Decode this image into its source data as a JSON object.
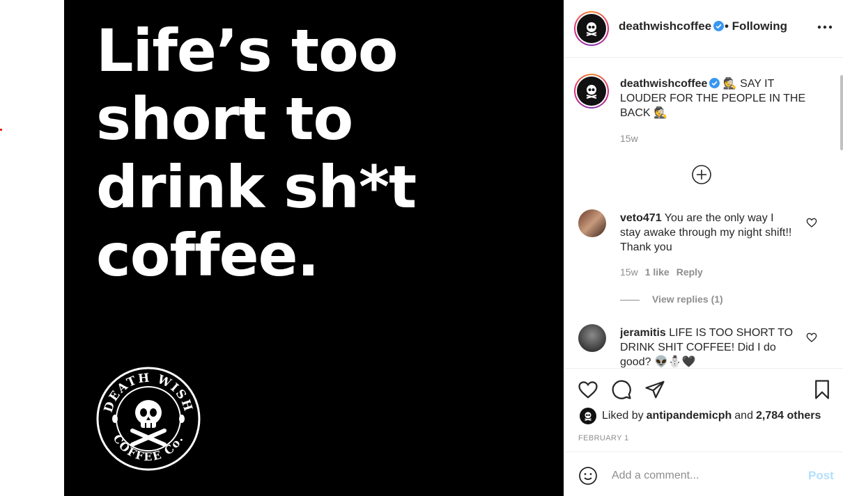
{
  "media": {
    "headline": "Life’s too\nshort to\ndrink sh*t\ncoffee.",
    "logo_top_text": "DEATH WISH",
    "logo_bottom_text": "COFFEE Co."
  },
  "header": {
    "username": "deathwishcoffee",
    "following_label": "• Following",
    "more_icon": "more-horizontal-icon"
  },
  "caption": {
    "username": "deathwishcoffee",
    "text": " 🕵 SAY IT LOUDER FOR THE PEOPLE IN THE BACK 🕵",
    "time": "15w"
  },
  "comments": [
    {
      "username": "veto471",
      "text": " You are the only way I stay awake through my night shift!! Thank you",
      "time": "15w",
      "likes": "1 like",
      "reply_label": "Reply",
      "view_replies": "View replies (1)"
    },
    {
      "username": "jeramitis",
      "text": " LIFE IS TOO SHORT TO DRINK SHIT COFFEE! Did I do good? 👽⛄🖤"
    }
  ],
  "actions": {
    "liked_prefix": "Liked by",
    "liked_user": "antipandemicph",
    "liked_and": "and",
    "liked_others": "2,784 others",
    "date": "FEBRUARY 1"
  },
  "comment_bar": {
    "placeholder": "Add a comment...",
    "post_label": "Post"
  },
  "colors": {
    "verified": "#3897f0",
    "post_disabled": "#b2dffc",
    "muted": "#8e8e8e"
  }
}
